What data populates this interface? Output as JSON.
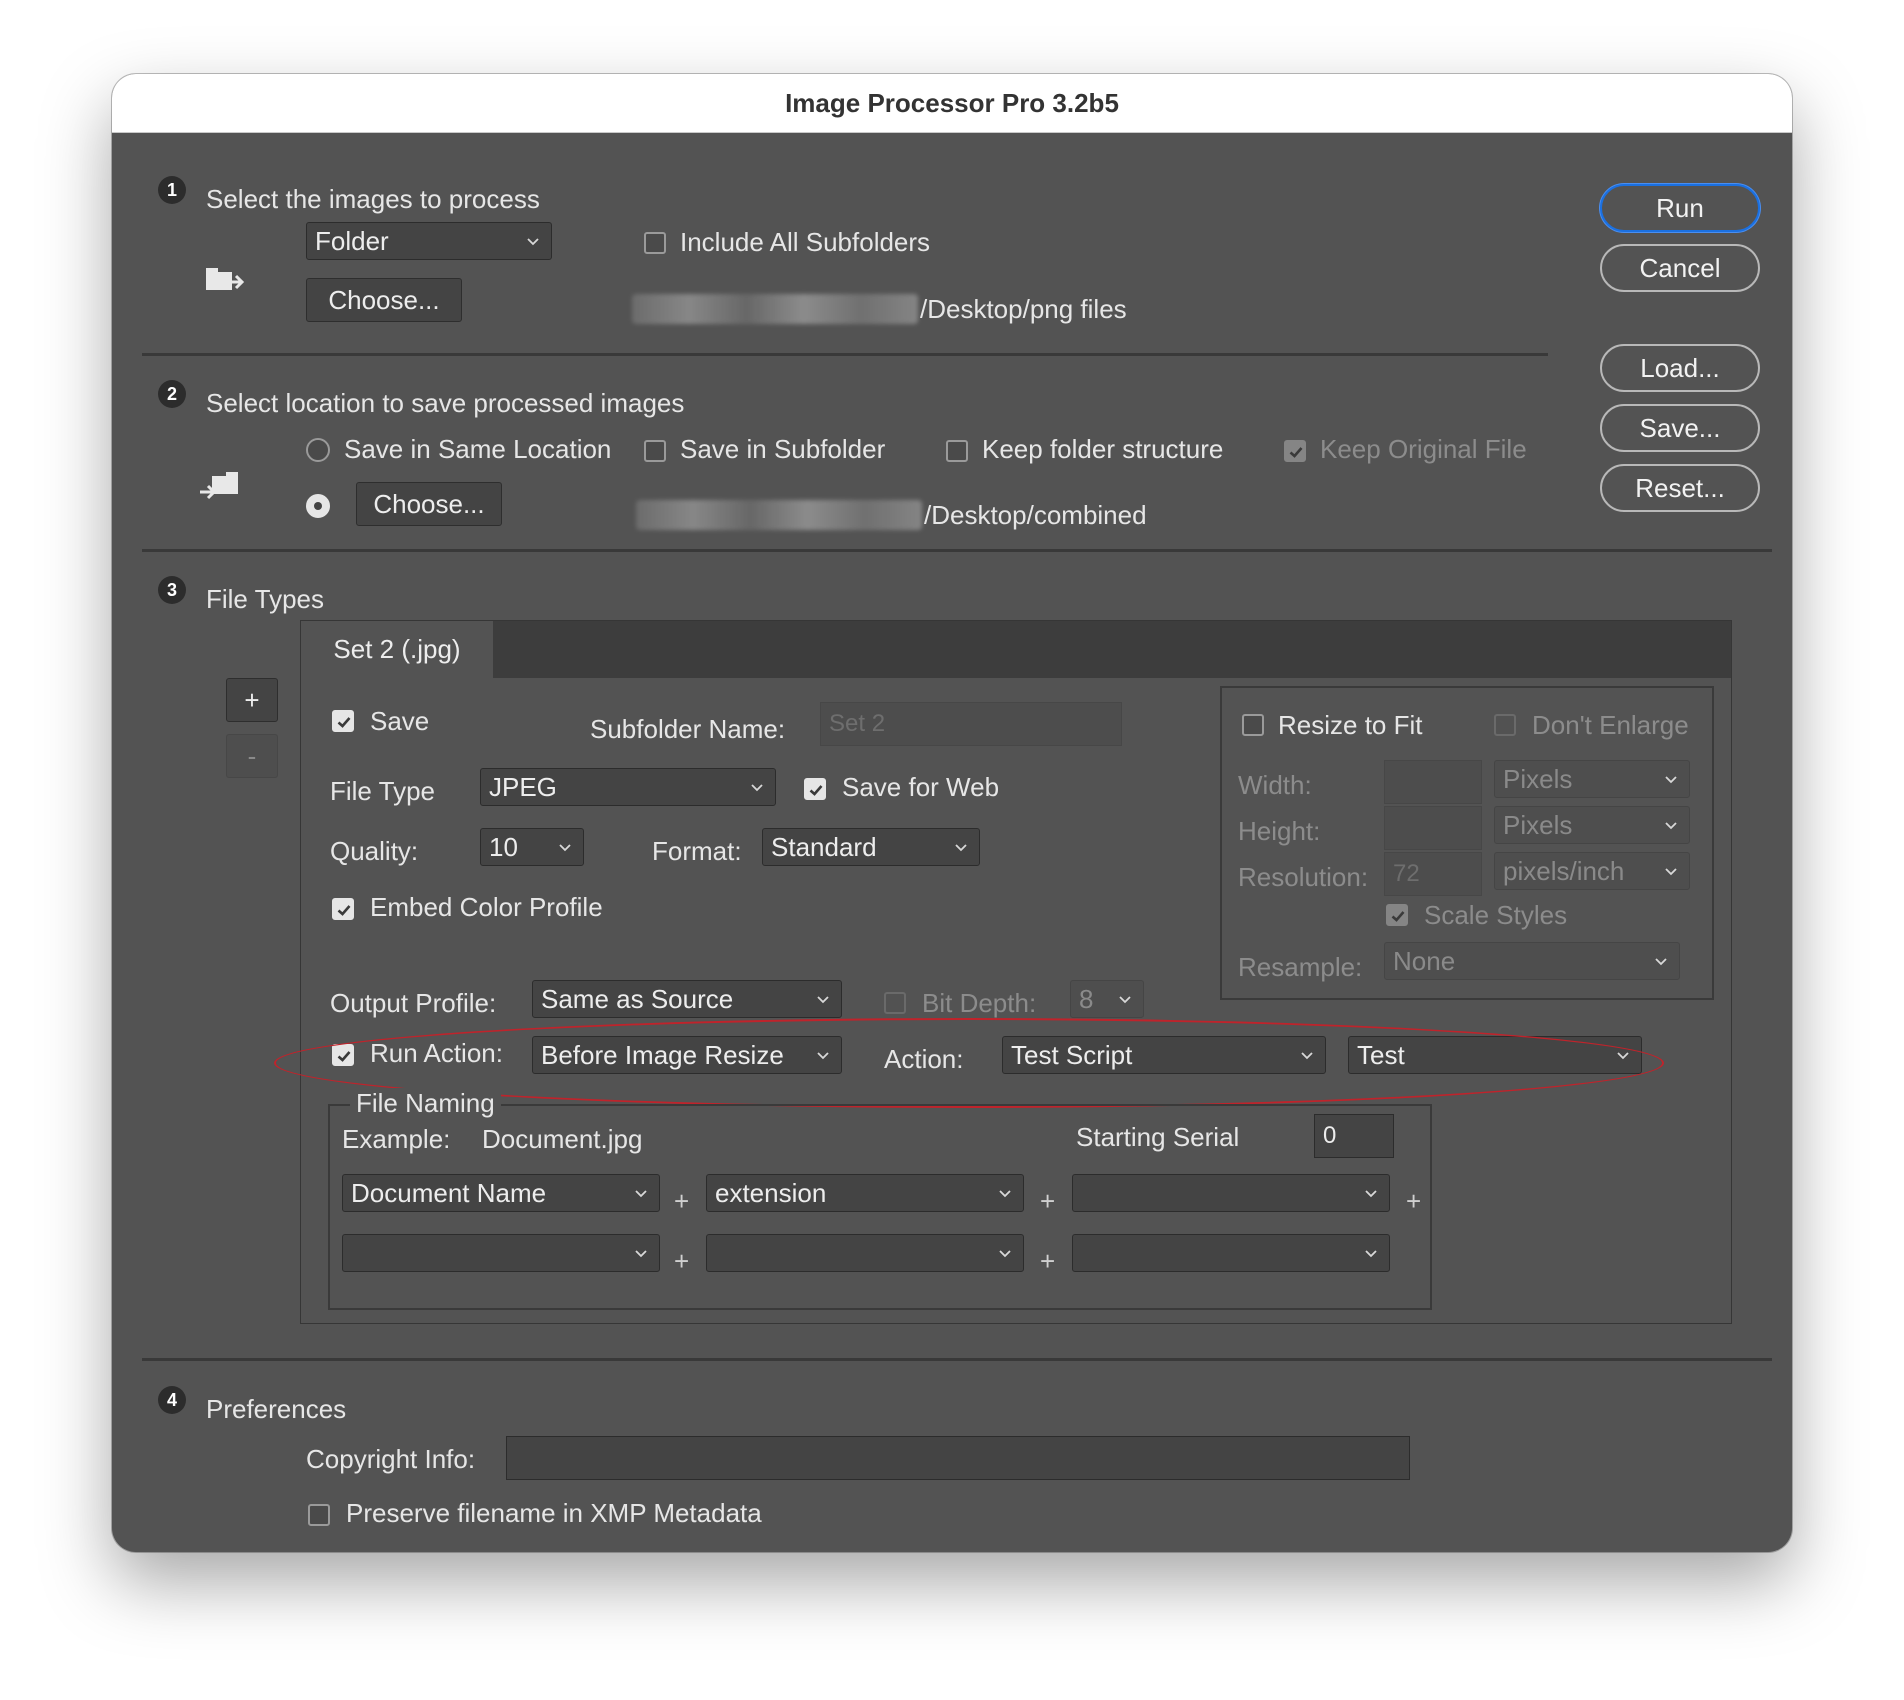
{
  "window": {
    "title": "Image Processor Pro 3.2b5"
  },
  "side_buttons": {
    "run": "Run",
    "cancel": "Cancel",
    "load": "Load...",
    "save": "Save...",
    "reset": "Reset..."
  },
  "step1": {
    "number": "1",
    "title": "Select the images to process",
    "source_select": "Folder",
    "include_subfolders": "Include All Subfolders",
    "include_subfolders_checked": false,
    "choose": "Choose...",
    "path_suffix": "/Desktop/png files"
  },
  "step2": {
    "number": "2",
    "title": "Select location to save processed images",
    "same_location": "Save in Same Location",
    "same_location_selected": false,
    "save_in_subfolder": "Save in Subfolder",
    "keep_folder_structure": "Keep folder structure",
    "keep_original_file": "Keep Original File",
    "keep_original_checked": true,
    "choose": "Choose...",
    "choose_selected": true,
    "path_suffix": "/Desktop/combined"
  },
  "step3": {
    "number": "3",
    "title": "File Types",
    "add_set": "+",
    "remove_set": "-",
    "tab_label": "Set 2 (.jpg)",
    "save_label": "Save",
    "save_checked": true,
    "subfolder_name_label": "Subfolder Name:",
    "subfolder_name_placeholder": "Set 2",
    "file_type_label": "File Type",
    "file_type_value": "JPEG",
    "save_for_web": "Save for Web",
    "save_for_web_checked": true,
    "quality_label": "Quality:",
    "quality_value": "10",
    "format_label": "Format:",
    "format_value": "Standard",
    "embed_color_profile": "Embed Color Profile",
    "embed_checked": true,
    "output_profile_label": "Output Profile:",
    "output_profile_value": "Same as Source",
    "bit_depth_label": "Bit Depth:",
    "bit_depth_value": "8",
    "run_action_label": "Run Action:",
    "run_action_checked": true,
    "run_action_value": "Before Image Resize",
    "action_label": "Action:",
    "action_set_value": "Test Script",
    "action_value": "Test",
    "resize": {
      "resize_to_fit": "Resize to Fit",
      "dont_enlarge": "Don't Enlarge",
      "width_label": "Width:",
      "width_unit": "Pixels",
      "height_label": "Height:",
      "height_unit": "Pixels",
      "resolution_label": "Resolution:",
      "resolution_value": "72",
      "resolution_unit": "pixels/inch",
      "scale_styles": "Scale Styles",
      "resample_label": "Resample:",
      "resample_value": "None"
    },
    "naming": {
      "title": "File Naming",
      "example_label": "Example:",
      "example_value": "Document.jpg",
      "starting_serial_label": "Starting Serial",
      "starting_serial_value": "0",
      "row1": [
        "Document Name",
        "extension",
        ""
      ],
      "row2": [
        "",
        "",
        ""
      ],
      "plus": "+"
    }
  },
  "step4": {
    "number": "4",
    "title": "Preferences",
    "copyright_label": "Copyright Info:",
    "copyright_value": "",
    "preserve_filename": "Preserve filename in XMP Metadata",
    "preserve_checked": false
  },
  "colors": {
    "window_bg": "#535353",
    "highlight_ellipse": "#c0232b",
    "primary_button": "#1b70e0"
  }
}
